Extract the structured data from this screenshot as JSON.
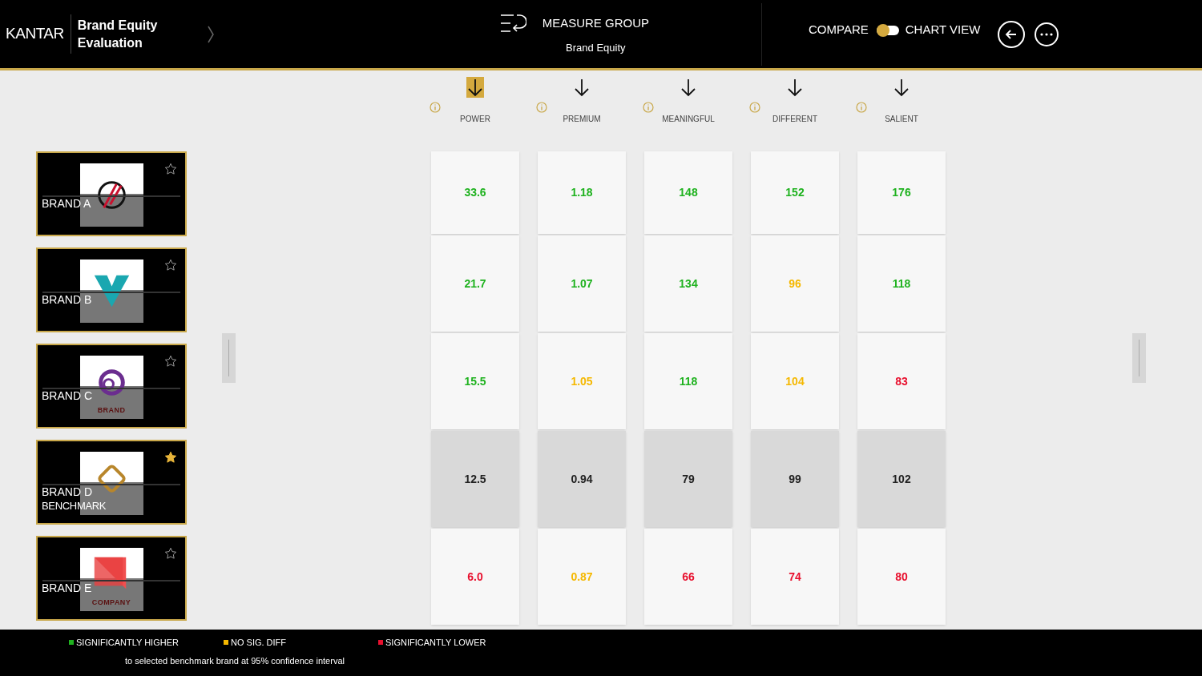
{
  "header": {
    "logo": "KANTAR",
    "title_line1": "Brand Equity",
    "title_line2": "Evaluation",
    "measure_group": {
      "label": "MEASURE GROUP",
      "value": "Brand Equity"
    },
    "compare": {
      "label": "COMPARE",
      "on": false
    },
    "chart_view": "CHART VIEW"
  },
  "columns": [
    {
      "label": "POWER",
      "selected": true
    },
    {
      "label": "PREMIUM",
      "selected": false
    },
    {
      "label": "MEANINGFUL",
      "selected": false
    },
    {
      "label": "DIFFERENT",
      "selected": false
    },
    {
      "label": "SALIENT",
      "selected": false
    }
  ],
  "brands": [
    {
      "name": "BRAND A",
      "kind": "circle",
      "starred": false,
      "benchmark": false,
      "cells": [
        {
          "value": "33.6",
          "color": "#1fb21f"
        },
        {
          "value": "1.18",
          "color": "#1fb21f"
        },
        {
          "value": "148",
          "color": "#1fb21f"
        },
        {
          "value": "152",
          "color": "#1fb21f"
        },
        {
          "value": "176",
          "color": "#1fb21f"
        }
      ]
    },
    {
      "name": "BRAND B",
      "kind": "v",
      "starred": false,
      "benchmark": false,
      "cells": [
        {
          "value": "21.7",
          "color": "#1fb21f"
        },
        {
          "value": "1.07",
          "color": "#1fb21f"
        },
        {
          "value": "134",
          "color": "#1fb21f"
        },
        {
          "value": "96",
          "color": "#f5b800"
        },
        {
          "value": "118",
          "color": "#1fb21f"
        }
      ]
    },
    {
      "name": "BRAND C",
      "kind": "swirl",
      "logo_text": "BRAND",
      "starred": false,
      "benchmark": false,
      "cells": [
        {
          "value": "15.5",
          "color": "#1fb21f"
        },
        {
          "value": "1.05",
          "color": "#f5b800"
        },
        {
          "value": "118",
          "color": "#1fb21f"
        },
        {
          "value": "104",
          "color": "#f5b800"
        },
        {
          "value": "83",
          "color": "#e8102e"
        }
      ]
    },
    {
      "name": "BRAND D",
      "kind": "diamond",
      "starred": true,
      "benchmark": true,
      "benchmark_label": "BENCHMARK",
      "cells": [
        {
          "value": "12.5",
          "color": "#222222"
        },
        {
          "value": "0.94",
          "color": "#222222"
        },
        {
          "value": "79",
          "color": "#222222"
        },
        {
          "value": "99",
          "color": "#222222"
        },
        {
          "value": "102",
          "color": "#222222"
        }
      ]
    },
    {
      "name": "BRAND E",
      "kind": "square",
      "logo_text": "COMPANY",
      "starred": false,
      "benchmark": false,
      "cells": [
        {
          "value": "6.0",
          "color": "#e8102e"
        },
        {
          "value": "0.87",
          "color": "#f5b800"
        },
        {
          "value": "66",
          "color": "#e8102e"
        },
        {
          "value": "74",
          "color": "#e8102e"
        },
        {
          "value": "80",
          "color": "#e8102e"
        }
      ]
    }
  ],
  "legend": {
    "items": [
      {
        "label": "SIGNIFICANTLY HIGHER",
        "color": "#1fb21f"
      },
      {
        "label": "NO SIG. DIFF",
        "color": "#f5b800"
      },
      {
        "label": "SIGNIFICANTLY LOWER",
        "color": "#e8102e"
      }
    ],
    "note": "to selected benchmark brand at 95% confidence interval"
  }
}
